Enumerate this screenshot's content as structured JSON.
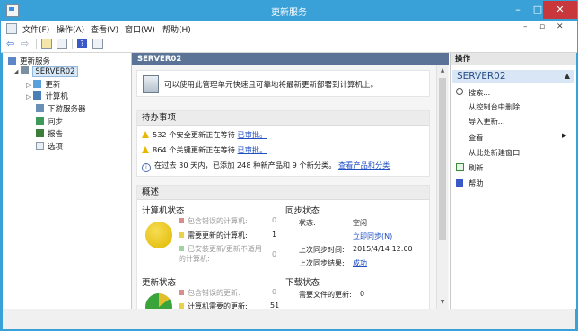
{
  "window": {
    "title": "更新服务",
    "min_label": "–",
    "max_label": "□",
    "close_label": "✕"
  },
  "menubar": {
    "items": [
      "文件(F)",
      "操作(A)",
      "查看(V)",
      "窗口(W)",
      "帮助(H)"
    ],
    "mdi_controls": [
      "–",
      "▫",
      "✕"
    ]
  },
  "toolbar": {
    "back": "⇦",
    "forward": "⇨",
    "help": "?"
  },
  "tree": {
    "root": "更新服务",
    "server": "SERVER02",
    "children": [
      "更新",
      "计算机",
      "下游服务器",
      "同步",
      "报告",
      "选项"
    ]
  },
  "center": {
    "header": "SERVER02",
    "intro": "可以使用此管理单元快速且可靠地将最新更新部署到计算机上。",
    "todo": {
      "title": "待办事项",
      "row1_text": "532 个安全更新正在等待",
      "row1_link": "已审批。",
      "row2_text": "864 个关键更新正在等待",
      "row2_link": "已审批。",
      "row3_text": "在过去 30 天内，已添加 248 种新产品和 9 个新分类。",
      "row3_link": "查看产品和分类"
    },
    "overview": {
      "title": "概述",
      "computer_status": {
        "title": "计算机状态",
        "items": [
          {
            "label": "包含错误的计算机:",
            "value": "0"
          },
          {
            "label": "需要更新的计算机:",
            "value": "1"
          },
          {
            "label": "已安装更新/更新不适用的计算机:",
            "value": "0"
          }
        ]
      },
      "sync_status": {
        "title": "同步状态",
        "status_label": "状态:",
        "status_value": "空闲",
        "sync_now": "立即同步(N)",
        "last_time_label": "上次同步时间:",
        "last_time_value": "2015/4/14 12:00",
        "last_result_label": "上次同步结果:",
        "last_result_value": "成功"
      },
      "update_status": {
        "title": "更新状态",
        "items": [
          {
            "label": "包含错误的更新:",
            "value": "0"
          },
          {
            "label": "计算机需要的更新:",
            "value": "51"
          }
        ]
      },
      "download_status": {
        "title": "下载状态",
        "needed_label": "需要文件的更新:",
        "needed_value": "0"
      }
    }
  },
  "actions": {
    "header": "操作",
    "section": "SERVER02",
    "items": [
      "搜索...",
      "从控制台中删除",
      "导入更新...",
      "查看",
      "从此处新建窗口",
      "刷新",
      "帮助"
    ]
  },
  "colors": {
    "title_bar": "#3aa0d8",
    "header_bar": "#5a7396",
    "link": "#1f4fc4",
    "legend_error": "#d98c8c",
    "legend_needed": "#e8d24a",
    "legend_ok": "#9fd39f"
  }
}
